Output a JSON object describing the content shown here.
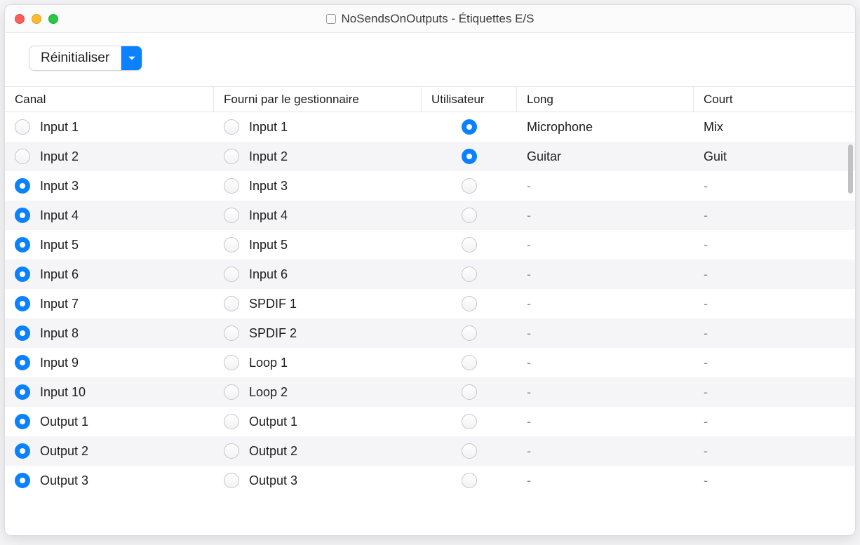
{
  "window": {
    "title": "NoSendsOnOutputs - Étiquettes E/S"
  },
  "toolbar": {
    "reset_label": "Réinitialiser"
  },
  "columns": {
    "canal": "Canal",
    "fourni": "Fourni par le gestionnaire",
    "utilisateur": "Utilisateur",
    "long": "Long",
    "court": "Court"
  },
  "rows": [
    {
      "canal": "Input 1",
      "canal_on": false,
      "fourni": "Input 1",
      "fourni_on": false,
      "user_on": true,
      "long": "Microphone",
      "court": "Mix"
    },
    {
      "canal": "Input 2",
      "canal_on": false,
      "fourni": "Input 2",
      "fourni_on": false,
      "user_on": true,
      "long": "Guitar",
      "court": "Guit"
    },
    {
      "canal": "Input 3",
      "canal_on": true,
      "fourni": "Input 3",
      "fourni_on": false,
      "user_on": false,
      "long": "-",
      "court": "-"
    },
    {
      "canal": "Input 4",
      "canal_on": true,
      "fourni": "Input 4",
      "fourni_on": false,
      "user_on": false,
      "long": "-",
      "court": "-"
    },
    {
      "canal": "Input 5",
      "canal_on": true,
      "fourni": "Input 5",
      "fourni_on": false,
      "user_on": false,
      "long": "-",
      "court": "-"
    },
    {
      "canal": "Input 6",
      "canal_on": true,
      "fourni": "Input 6",
      "fourni_on": false,
      "user_on": false,
      "long": "-",
      "court": "-"
    },
    {
      "canal": "Input 7",
      "canal_on": true,
      "fourni": "SPDIF 1",
      "fourni_on": false,
      "user_on": false,
      "long": "-",
      "court": "-"
    },
    {
      "canal": "Input 8",
      "canal_on": true,
      "fourni": "SPDIF 2",
      "fourni_on": false,
      "user_on": false,
      "long": "-",
      "court": "-"
    },
    {
      "canal": "Input 9",
      "canal_on": true,
      "fourni": "Loop 1",
      "fourni_on": false,
      "user_on": false,
      "long": "-",
      "court": "-"
    },
    {
      "canal": "Input 10",
      "canal_on": true,
      "fourni": "Loop 2",
      "fourni_on": false,
      "user_on": false,
      "long": "-",
      "court": "-"
    },
    {
      "canal": "Output 1",
      "canal_on": true,
      "fourni": "Output 1",
      "fourni_on": false,
      "user_on": false,
      "long": "-",
      "court": "-"
    },
    {
      "canal": "Output 2",
      "canal_on": true,
      "fourni": "Output 2",
      "fourni_on": false,
      "user_on": false,
      "long": "-",
      "court": "-"
    },
    {
      "canal": "Output 3",
      "canal_on": true,
      "fourni": "Output 3",
      "fourni_on": false,
      "user_on": false,
      "long": "-",
      "court": "-"
    }
  ]
}
